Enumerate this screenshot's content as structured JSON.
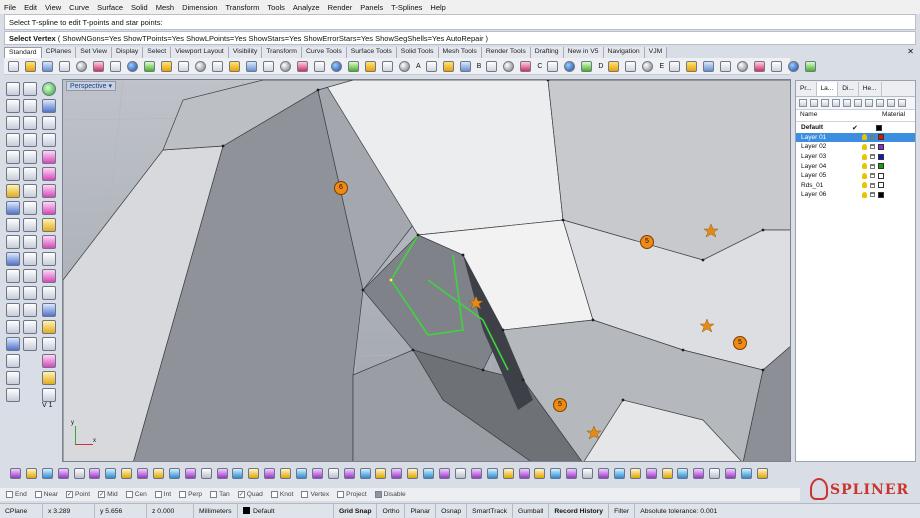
{
  "menu": [
    "File",
    "Edit",
    "View",
    "Curve",
    "Surface",
    "Solid",
    "Mesh",
    "Dimension",
    "Transform",
    "Tools",
    "Analyze",
    "Render",
    "Panels",
    "T-Splines",
    "Help"
  ],
  "command": {
    "history": "Select T-spline to edit T-points and star points:",
    "prompt_label": "Select Vertex",
    "prompt_options": "( ShowNGons=Yes  ShowTPoints=Yes  ShowLPoints=Yes  ShowStars=Yes  ShowErrorStars=Yes  ShowSegShells=Yes  AutoRepair )"
  },
  "toolbar_tabs": [
    "Standard",
    "CPlanes",
    "Set View",
    "Display",
    "Select",
    "Viewport Layout",
    "Visibility",
    "Transform",
    "Curve Tools",
    "Surface Tools",
    "Solid Tools",
    "Mesh Tools",
    "Render Tools",
    "Drafting",
    "New in V5",
    "Navigation",
    "VJM"
  ],
  "toolbar_letters": [
    "A",
    "B",
    "C",
    "D",
    "E"
  ],
  "viewport": {
    "title": "Perspective",
    "markers": [
      "6",
      "5",
      "5",
      "5"
    ],
    "axis_x": "x",
    "axis_y": "y"
  },
  "left_label": "V 1",
  "panel": {
    "tabs": [
      "Pr...",
      "La...",
      "Di...",
      "He..."
    ],
    "col_name": "Name",
    "col_material": "Material",
    "layers": [
      {
        "name": "Default",
        "current": true,
        "color": "#000000",
        "selected": false
      },
      {
        "name": "Layer 01",
        "current": false,
        "color": "#e81010",
        "selected": true
      },
      {
        "name": "Layer 02",
        "current": false,
        "color": "#8b2ccf",
        "selected": false
      },
      {
        "name": "Layer 03",
        "current": false,
        "color": "#1414c8",
        "selected": false
      },
      {
        "name": "Layer 04",
        "current": false,
        "color": "#14a014",
        "selected": false
      },
      {
        "name": "Layer 05",
        "current": false,
        "color": "#ffffff",
        "selected": false
      },
      {
        "name": "Rds_01",
        "current": false,
        "color": "#ffffff",
        "selected": false
      },
      {
        "name": "Layer 06",
        "current": false,
        "color": "#000000",
        "selected": false
      }
    ]
  },
  "snaps": [
    {
      "label": "End",
      "checked": false
    },
    {
      "label": "Near",
      "checked": false
    },
    {
      "label": "Point",
      "checked": true
    },
    {
      "label": "Mid",
      "checked": true
    },
    {
      "label": "Cen",
      "checked": false
    },
    {
      "label": "Int",
      "checked": false
    },
    {
      "label": "Perp",
      "checked": false
    },
    {
      "label": "Tan",
      "checked": false
    },
    {
      "label": "Quad",
      "checked": true
    },
    {
      "label": "Knot",
      "checked": false
    },
    {
      "label": "Vertex",
      "checked": false
    },
    {
      "label": "Project",
      "checked": false
    },
    {
      "label": "Disable",
      "checked": false
    }
  ],
  "status": {
    "cplane": "CPlane",
    "x": "x 3.289",
    "y": "y 5.656",
    "z": "z 0.000",
    "units": "Millimeters",
    "layer": "Default",
    "grid_snap": "Grid Snap",
    "ortho": "Ortho",
    "planar": "Planar",
    "osnap": "Osnap",
    "smarttrack": "SmartTrack",
    "gumball": "Gumball",
    "record_history": "Record History",
    "filter": "Filter",
    "tolerance": "Absolute tolerance: 0.001"
  },
  "logo": {
    "text": "SPLINER"
  }
}
